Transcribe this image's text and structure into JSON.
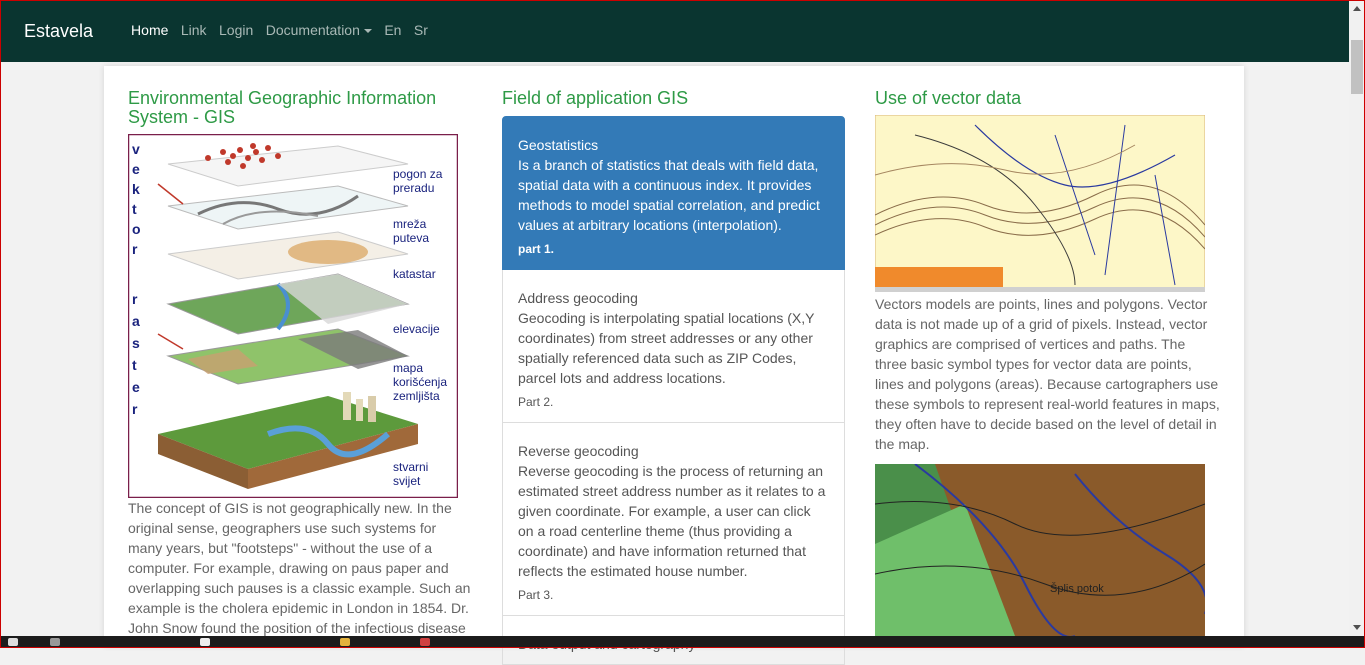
{
  "navbar": {
    "brand": "Estavela",
    "links": [
      "Home",
      "Link",
      "Login",
      "Documentation",
      "En",
      "Sr"
    ]
  },
  "col1": {
    "title": "Environmental Geographic Information System - GIS",
    "image_labels": {
      "vektor": "v e k t o r",
      "raster": "r a s t e r",
      "layer1": "pogon za preradu",
      "layer2": "mreža puteva",
      "layer3": "katastar",
      "layer4": "elevacije",
      "layer5": "mapa korišćenja zemljišta",
      "layer6": "stvarni svijet"
    },
    "text": "The concept of GIS is not geographically new. In the original sense, geographers use such systems for many years, but \"footsteps\" - without the use of a computer. For example, drawing on paus paper and overlapping such pauses is a classic example. Such an example is the cholera epidemic in London in 1854. Dr. John Snow found the position of the infectious disease"
  },
  "col2": {
    "title": "Field of application GIS",
    "items": [
      {
        "title": "Geostatistics",
        "text": "Is a branch of statistics that deals with field data, spatial data with a continuous index. It provides methods to model spatial correlation, and predict values at arbitrary locations (interpolation).",
        "part": "part 1."
      },
      {
        "title": "Address geocoding",
        "text": "Geocoding is interpolating spatial locations (X,Y coordinates) from street addresses or any other spatially referenced data such as ZIP Codes, parcel lots and address locations.",
        "part": "Part 2."
      },
      {
        "title": "Reverse geocoding",
        "text": "Reverse geocoding is the process of returning an estimated street address number as it relates to a given coordinate. For example, a user can click on a road centerline theme (thus providing a coordinate) and have information returned that reflects the estimated house number.",
        "part": "Part 3."
      },
      {
        "title": "Data output and cartography",
        "text": "",
        "part": ""
      }
    ]
  },
  "col3": {
    "title": "Use of vector data",
    "text": "Vectors models are points, lines and polygons. Vector data is not made up of a grid of pixels. Instead, vector graphics are comprised of vertices and paths. The three basic symbol types for vector data are points, lines and polygons (areas). Because cartographers use these symbols to represent real-world features in maps, they often have to decide based on the level of detail in the map.",
    "map2_label": "Šplis potok"
  }
}
